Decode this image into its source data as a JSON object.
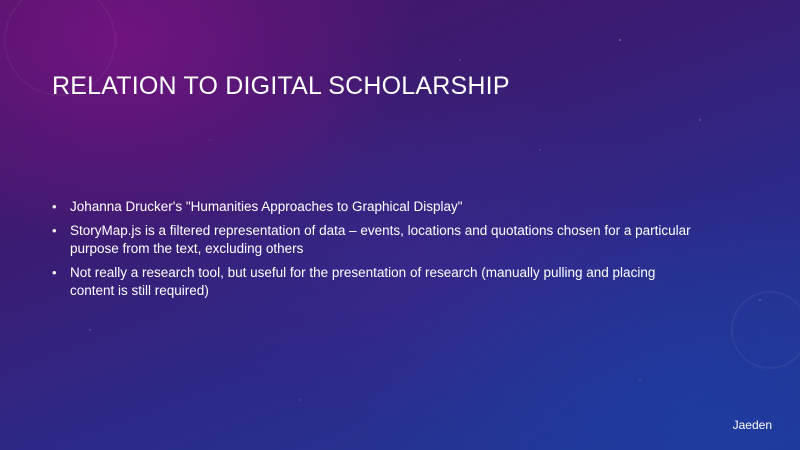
{
  "slide": {
    "title": "RELATION TO DIGITAL SCHOLARSHIP",
    "bullets": [
      "Johanna Drucker's \"Humanities Approaches to Graphical Display\"",
      "StoryMap.js is a filtered representation of data – events, locations and quotations chosen for a particular purpose from the text, excluding others",
      "Not really a research tool, but useful for the presentation of research (manually pulling and placing content is still required)"
    ],
    "author": "Jaeden",
    "bullet_symbol": "•"
  },
  "colors": {
    "background_top": "#4a1466",
    "background_bottom": "#1f3a96",
    "text": "#ffffff"
  }
}
